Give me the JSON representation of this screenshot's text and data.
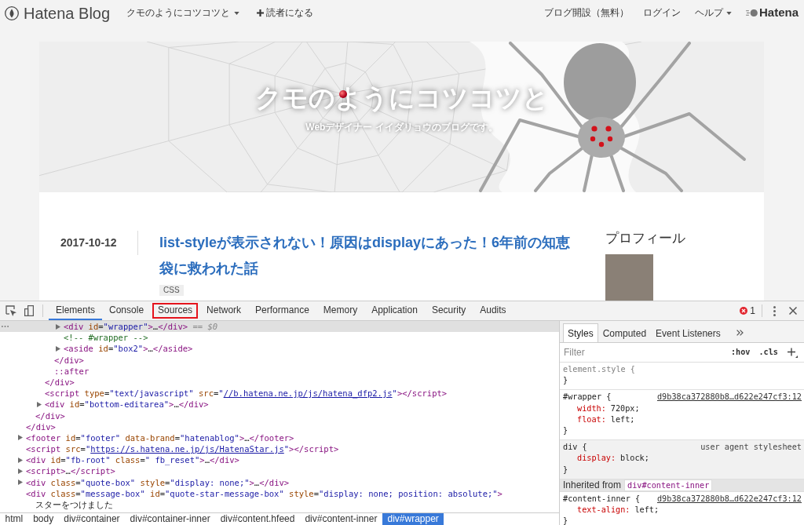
{
  "nav": {
    "logo": "Hatena Blog",
    "blog_menu": "クモのようにコツコツと",
    "subscribe": "読者になる",
    "links": [
      {
        "label": "ブログ開設（無料）",
        "has_menu": false
      },
      {
        "label": "ログイン",
        "has_menu": false
      },
      {
        "label": "ヘルプ",
        "has_menu": true
      }
    ],
    "brand": "Hatena"
  },
  "header": {
    "title": "クモのようにコツコツと",
    "subtitle": "Webデザイナー イイダリョウのブログです。"
  },
  "post": {
    "date": "2017-10-12",
    "title": "list-styleが表示されない！原因はdisplayにあった！6年前の知恵袋に救われた話",
    "tags": [
      "CSS"
    ]
  },
  "sidebar": {
    "heading": "プロフィール"
  },
  "devtools": {
    "tabs": [
      {
        "label": "Elements",
        "selected": true,
        "annotated": false
      },
      {
        "label": "Console",
        "selected": false,
        "annotated": false
      },
      {
        "label": "Sources",
        "selected": false,
        "annotated": true
      },
      {
        "label": "Network",
        "selected": false,
        "annotated": false
      },
      {
        "label": "Performance",
        "selected": false,
        "annotated": false
      },
      {
        "label": "Memory",
        "selected": false,
        "annotated": false
      },
      {
        "label": "Application",
        "selected": false,
        "annotated": false
      },
      {
        "label": "Security",
        "selected": false,
        "annotated": false
      },
      {
        "label": "Audits",
        "selected": false,
        "annotated": false
      }
    ],
    "error_count": "1",
    "dom_tree": [
      {
        "selected": false,
        "children": [
          {
            "selected": false,
            "children": [
              {
                "selected": false,
                "children": [
                  {
                    "selected": false,
                    "children": [
                      {
                        "open": [
                          {
                            "kind": "tag",
                            "text": "<div"
                          },
                          {
                            "kind": "attr",
                            "text": " id"
                          },
                          {
                            "kind": "plain",
                            "text": "="
                          },
                          {
                            "kind": "value",
                            "text": "\"wrapper\""
                          },
                          {
                            "kind": "tag",
                            "text": ">"
                          },
                          {
                            "kind": "plain",
                            "text": "…"
                          },
                          {
                            "kind": "tag",
                            "text": "</div>"
                          },
                          {
                            "kind": "hint",
                            "text": " == $0"
                          }
                        ],
                        "selected": true,
                        "collapsed": true
                      },
                      {
                        "open": [
                          {
                            "kind": "comment",
                            "text": "<!-- #wrapper -->"
                          }
                        ],
                        "selected": false,
                        "collapsed": false
                      },
                      {
                        "open": [
                          {
                            "kind": "tag",
                            "text": "<aside"
                          },
                          {
                            "kind": "attr",
                            "text": " id"
                          },
                          {
                            "kind": "plain",
                            "text": "="
                          },
                          {
                            "kind": "value",
                            "text": "\"box2\""
                          },
                          {
                            "kind": "tag",
                            "text": ">"
                          },
                          {
                            "kind": "plain",
                            "text": "…"
                          },
                          {
                            "kind": "tag",
                            "text": "</aside>"
                          }
                        ],
                        "selected": false,
                        "collapsed": true
                      }
                    ],
                    "close": [
                      {
                        "kind": "tag",
                        "text": "</div>"
                      }
                    ]
                  },
                  {
                    "open": [
                      {
                        "kind": "pseudo",
                        "text": "::after"
                      }
                    ],
                    "selected": false,
                    "collapsed": false
                  }
                ],
                "close": [
                  {
                    "kind": "tag",
                    "text": "</div>"
                  }
                ]
              },
              {
                "open": [
                  {
                    "kind": "tag",
                    "text": "<script"
                  },
                  {
                    "kind": "attr",
                    "text": " type"
                  },
                  {
                    "kind": "plain",
                    "text": "="
                  },
                  {
                    "kind": "value",
                    "text": "\"text/javascript\""
                  },
                  {
                    "kind": "attr",
                    "text": " src"
                  },
                  {
                    "kind": "plain",
                    "text": "="
                  },
                  {
                    "kind": "value",
                    "text": "\""
                  },
                  {
                    "kind": "link",
                    "text": "//b.hatena.ne.jp/js/hatena_dfp2.js"
                  },
                  {
                    "kind": "value",
                    "text": "\""
                  },
                  {
                    "kind": "tag",
                    "text": "></script>"
                  }
                ],
                "selected": false,
                "collapsed": false
              },
              {
                "open": [
                  {
                    "kind": "tag",
                    "text": "<div"
                  },
                  {
                    "kind": "attr",
                    "text": " id"
                  },
                  {
                    "kind": "plain",
                    "text": "="
                  },
                  {
                    "kind": "value",
                    "text": "\"bottom-editarea\""
                  },
                  {
                    "kind": "tag",
                    "text": ">"
                  },
                  {
                    "kind": "plain",
                    "text": "…"
                  },
                  {
                    "kind": "tag",
                    "text": "</div>"
                  }
                ],
                "selected": false,
                "collapsed": true
              }
            ],
            "close": [
              {
                "kind": "tag",
                "text": "</div>"
              }
            ]
          }
        ],
        "close": [
          {
            "kind": "tag",
            "text": "</div>"
          }
        ]
      },
      {
        "open": [
          {
            "kind": "tag",
            "text": "<footer"
          },
          {
            "kind": "attr",
            "text": " id"
          },
          {
            "kind": "plain",
            "text": "="
          },
          {
            "kind": "value",
            "text": "\"footer\""
          },
          {
            "kind": "attr",
            "text": " data-brand"
          },
          {
            "kind": "plain",
            "text": "="
          },
          {
            "kind": "value",
            "text": "\"hatenablog\""
          },
          {
            "kind": "tag",
            "text": ">"
          },
          {
            "kind": "plain",
            "text": "…"
          },
          {
            "kind": "tag",
            "text": "</footer>"
          }
        ],
        "selected": false,
        "collapsed": true
      },
      {
        "open": [
          {
            "kind": "tag",
            "text": "<script"
          },
          {
            "kind": "attr",
            "text": " src"
          },
          {
            "kind": "plain",
            "text": "="
          },
          {
            "kind": "value",
            "text": "\""
          },
          {
            "kind": "link",
            "text": "https://s.hatena.ne.jp/js/HatenaStar.js"
          },
          {
            "kind": "value",
            "text": "\""
          },
          {
            "kind": "tag",
            "text": "></script>"
          }
        ],
        "selected": false,
        "collapsed": false
      },
      {
        "open": [
          {
            "kind": "tag",
            "text": "<div"
          },
          {
            "kind": "attr",
            "text": " id"
          },
          {
            "kind": "plain",
            "text": "="
          },
          {
            "kind": "value",
            "text": "\"fb-root\""
          },
          {
            "kind": "attr",
            "text": " class"
          },
          {
            "kind": "plain",
            "text": "="
          },
          {
            "kind": "value",
            "text": "\" fb_reset\""
          },
          {
            "kind": "tag",
            "text": ">"
          },
          {
            "kind": "plain",
            "text": "…"
          },
          {
            "kind": "tag",
            "text": "</div>"
          }
        ],
        "selected": false,
        "collapsed": true
      },
      {
        "open": [
          {
            "kind": "tag",
            "text": "<script>"
          },
          {
            "kind": "plain",
            "text": "…"
          },
          {
            "kind": "tag",
            "text": "</script>"
          }
        ],
        "selected": false,
        "collapsed": true
      },
      {
        "open": [
          {
            "kind": "tag",
            "text": "<div"
          },
          {
            "kind": "attr",
            "text": " class"
          },
          {
            "kind": "plain",
            "text": "="
          },
          {
            "kind": "value",
            "text": "\"quote-box\""
          },
          {
            "kind": "attr",
            "text": " style"
          },
          {
            "kind": "plain",
            "text": "="
          },
          {
            "kind": "value",
            "text": "\"display: none;\""
          },
          {
            "kind": "tag",
            "text": ">"
          },
          {
            "kind": "plain",
            "text": "…"
          },
          {
            "kind": "tag",
            "text": "</div>"
          }
        ],
        "selected": false,
        "collapsed": true
      },
      {
        "open": [
          {
            "kind": "tag",
            "text": "<div"
          },
          {
            "kind": "attr",
            "text": " class"
          },
          {
            "kind": "plain",
            "text": "="
          },
          {
            "kind": "value",
            "text": "\"message-box\""
          },
          {
            "kind": "attr",
            "text": " id"
          },
          {
            "kind": "plain",
            "text": "="
          },
          {
            "kind": "value",
            "text": "\"quote-star-message-box\""
          },
          {
            "kind": "attr",
            "text": " style"
          },
          {
            "kind": "plain",
            "text": "="
          },
          {
            "kind": "value",
            "text": "\"display: none; position: absolute;\""
          },
          {
            "kind": "tag",
            "text": ">"
          }
        ],
        "selected": false,
        "collapsed": false,
        "children": [
          {
            "open": [
              {
                "kind": "plain",
                "text": "スターをつけました"
              }
            ],
            "selected": false,
            "collapsed": false
          }
        ]
      }
    ],
    "breadcrumbs": [
      {
        "label": "html",
        "selected": false
      },
      {
        "label": "body",
        "selected": false
      },
      {
        "label": "div#container",
        "selected": false
      },
      {
        "label": "div#container-inner",
        "selected": false
      },
      {
        "label": "div#content.hfeed",
        "selected": false
      },
      {
        "label": "div#content-inner",
        "selected": false
      },
      {
        "label": "div#wrapper",
        "selected": true
      }
    ],
    "styles": {
      "tabs": [
        {
          "label": "Styles",
          "selected": true
        },
        {
          "label": "Computed",
          "selected": false
        },
        {
          "label": "Event Listeners",
          "selected": false
        }
      ],
      "filter": {
        "placeholder": "Filter"
      },
      "toggles": [
        ":hov",
        ".cls"
      ],
      "rules": [
        {
          "kind": "inline",
          "selector": "element.style {",
          "close": "}"
        },
        {
          "kind": "author",
          "selector": "#wrapper {",
          "source": "d9b38ca372880b8…d622e247cf3:12",
          "declarations": [
            {
              "property": "width:",
              "value": "720px;"
            },
            {
              "property": "float:",
              "value": "left;"
            }
          ],
          "close": "}"
        },
        {
          "kind": "user_agent",
          "selector": "div {",
          "source": "user agent stylesheet",
          "declarations": [
            {
              "property": "display:",
              "value": "block;"
            }
          ],
          "close": "}"
        },
        {
          "kind": "inherited_header",
          "label": "Inherited from",
          "node": "div#content-inner"
        },
        {
          "kind": "author",
          "selector": "#content-inner {",
          "source": "d9b38ca372880b8…d622e247cf3:12",
          "declarations": [
            {
              "property": "text-align:",
              "value": "left;"
            }
          ],
          "close": "}"
        }
      ]
    }
  }
}
